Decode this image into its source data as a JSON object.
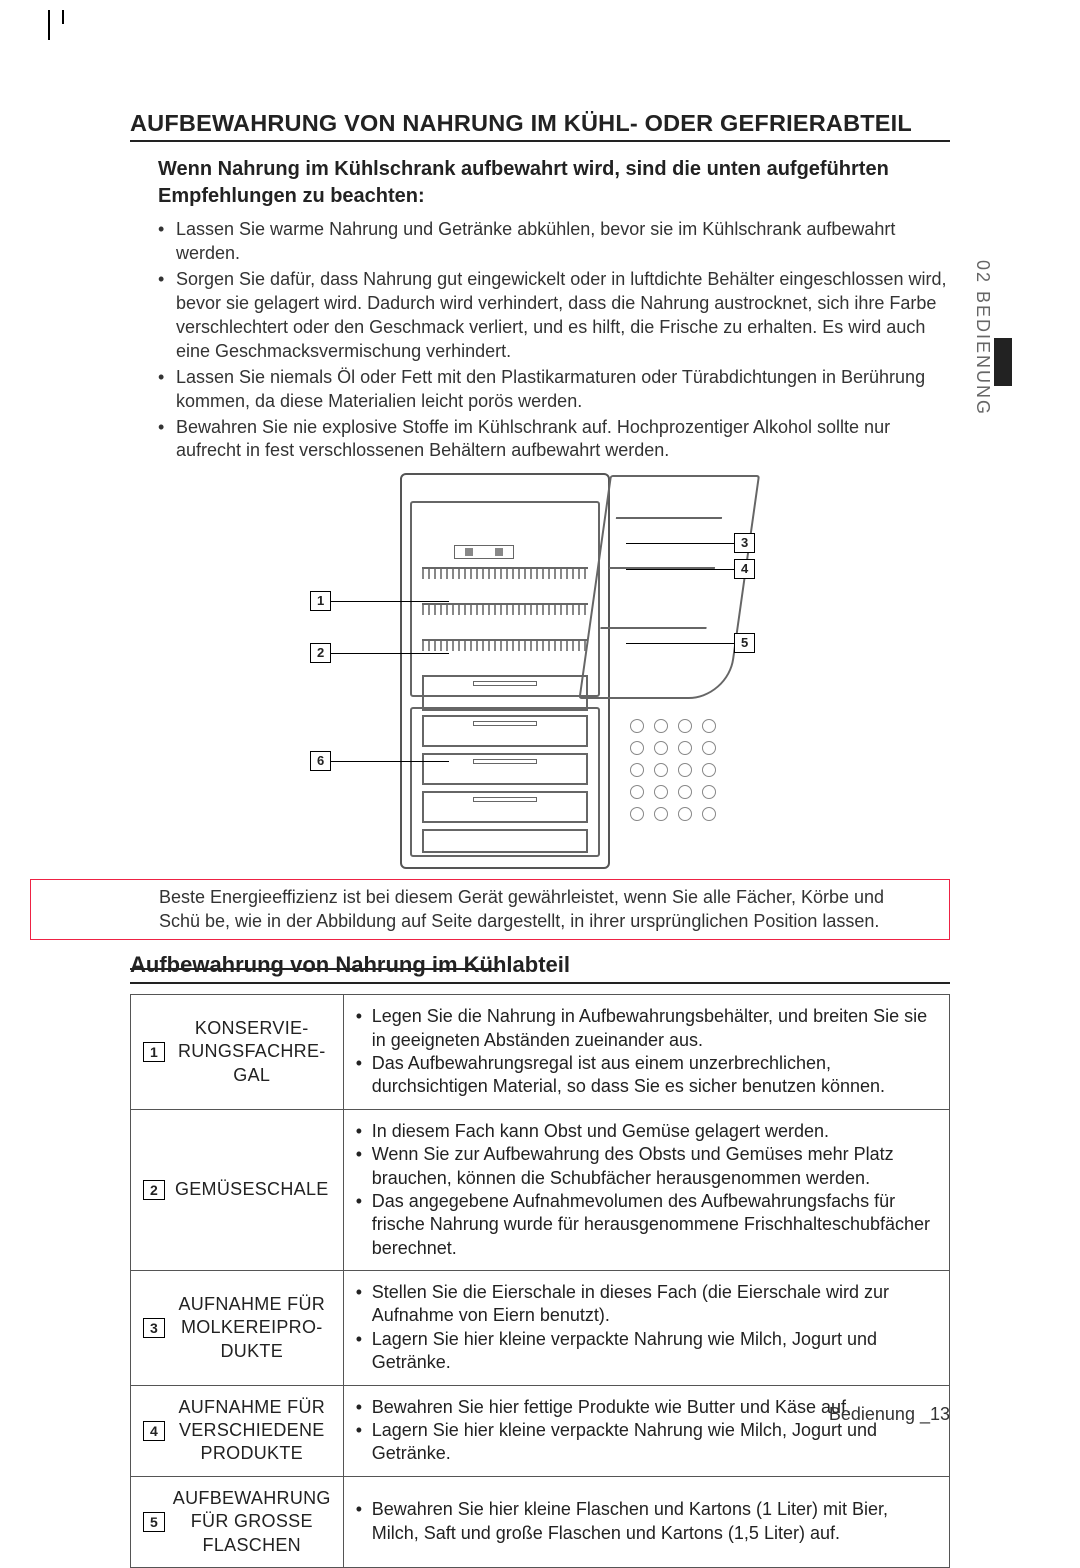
{
  "side_tab": "02 BEDIENUNG",
  "title": "AUFBEWAHRUNG VON NAHRUNG IM KÜHL- ODER GEFRIERABTEIL",
  "intro": "Wenn Nahrung im Kühlschrank aufbewahrt wird, sind die unten aufgeführten Empfehlungen zu beachten:",
  "bullets": [
    "Lassen Sie warme Nahrung und Getränke abkühlen, bevor sie im Kühlschrank aufbewahrt werden.",
    "Sorgen Sie dafür, dass Nahrung gut eingewickelt oder in luftdichte Behälter eingeschlossen wird, bevor sie gelagert wird. Dadurch wird verhindert, dass die Nahrung austrocknet, sich ihre Farbe verschlechtert oder den Geschmack verliert, und es hilft, die Frische zu erhalten. Es wird auch eine Geschmacksvermischung verhindert.",
    "Lassen Sie niemals Öl oder Fett mit den Plastikarmaturen oder Türabdichtungen in Berührung kommen, da diese Materialien leicht porös werden.",
    "Bewahren Sie nie explosive Stoffe im Kühlschrank auf. Hochprozentiger Alkohol sollte nur aufrecht in fest verschlossenen Behältern aufbewahrt werden."
  ],
  "diagram_labels": {
    "1": "1",
    "2": "2",
    "3": "3",
    "4": "4",
    "5": "5",
    "6": "6"
  },
  "note": "Beste Energieeffizienz ist bei diesem Gerät gewährleistet, wenn Sie alle Fächer, Körbe und Schü be, wie in der Abbildung auf Seite  dargestellt, in ihrer ursprünglichen Position lassen.",
  "sub_heading": "Aufbewahrung von Nahrung im Kühlabteil",
  "rows": [
    {
      "num": "1",
      "label": "KONSERVIE-RUNGSFACHRE-GAL",
      "points": [
        "Legen Sie die Nahrung in Aufbewahrungsbehälter, und breiten Sie sie in geeigneten Abständen zueinander aus.",
        "Das Aufbewahrungsregal ist aus einem unzerbrechlichen, durchsichtigen Material, so dass Sie es sicher benutzen können."
      ]
    },
    {
      "num": "2",
      "label": "GEMÜSESCHALE",
      "points": [
        "In diesem Fach kann Obst und Gemüse gelagert werden.",
        "Wenn Sie zur Aufbewahrung des Obsts und Gemüses mehr Platz brauchen, können die Schubfächer herausgenommen werden.",
        "Das angegebene Aufnahmevolumen des Aufbewahrungsfachs für frische Nahrung wurde für herausgenommene Frischhalteschubfächer berechnet."
      ]
    },
    {
      "num": "3",
      "label": "AUFNAHME FÜR MOLKEREIPRO-DUKTE",
      "points": [
        "Stellen Sie die Eierschale in dieses Fach (die Eierschale wird zur Aufnahme von Eiern benutzt).",
        "Lagern Sie hier kleine verpackte Nahrung wie Milch, Jogurt und Getränke."
      ]
    },
    {
      "num": "4",
      "label": "AUFNAHME FÜR VERSCHIEDENE PRODUKTE",
      "points": [
        "Bewahren Sie hier fettige Produkte wie Butter und Käse auf.",
        "Lagern Sie hier kleine verpackte Nahrung wie Milch, Jogurt und Getränke."
      ]
    },
    {
      "num": "5",
      "label": "AUFBEWAHRUNG FÜR GROSSE FLASCHEN",
      "points": [
        "Bewahren Sie hier kleine Flaschen und Kartons (1 Liter) mit Bier, Milch, Saft und große Flaschen und Kartons (1,5 Liter) auf."
      ]
    }
  ],
  "footer": "Bedienung _13"
}
